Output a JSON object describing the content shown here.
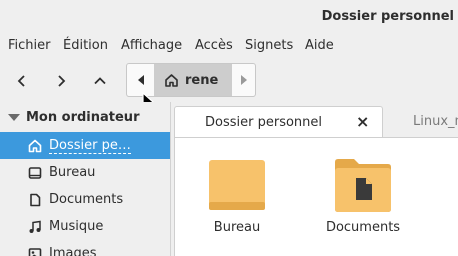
{
  "window": {
    "title": "Dossier personnel"
  },
  "menubar": [
    "Fichier",
    "Édition",
    "Affichage",
    "Accès",
    "Signets",
    "Aide"
  ],
  "pathbar": {
    "crumb": "rene"
  },
  "sidebar": {
    "header": "Mon ordinateur",
    "items": [
      {
        "label": "Dossier pe…",
        "icon": "home-icon"
      },
      {
        "label": "Bureau",
        "icon": "desktop-icon"
      },
      {
        "label": "Documents",
        "icon": "document-icon"
      },
      {
        "label": "Musique",
        "icon": "music-icon"
      },
      {
        "label": "Images",
        "icon": "image-icon"
      }
    ]
  },
  "tabs": [
    {
      "label": "Dossier personnel",
      "close": "×"
    },
    {
      "label": "Linux_m"
    }
  ],
  "files": [
    {
      "label": "Bureau",
      "icon": "folder-icon"
    },
    {
      "label": "Documents",
      "icon": "folder-documents-icon"
    }
  ],
  "colors": {
    "selection": "#3c99dd",
    "folder": "#f7c26b"
  }
}
